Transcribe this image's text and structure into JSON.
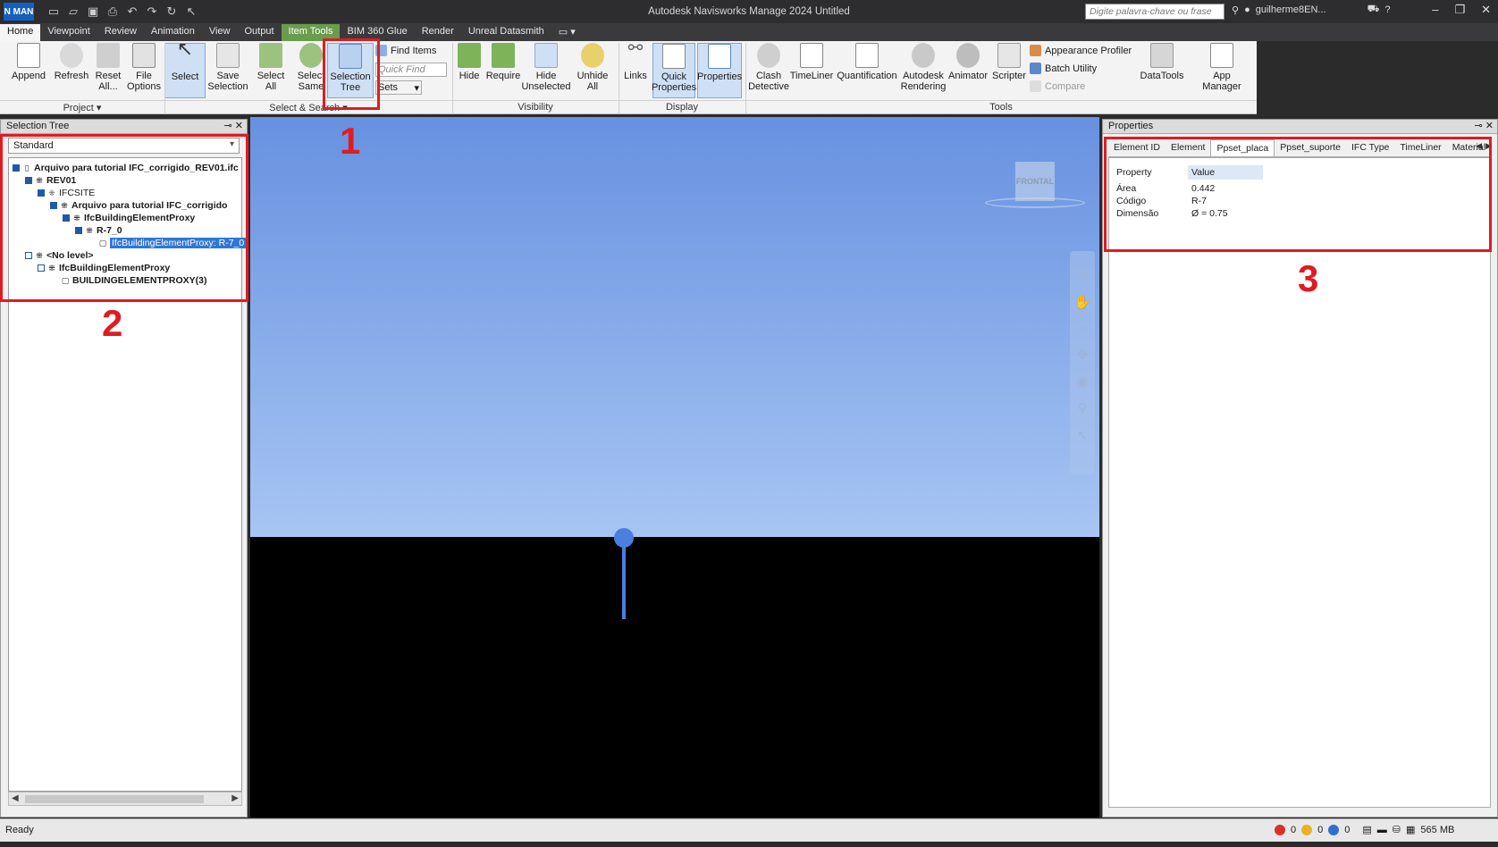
{
  "titlebar": {
    "logo": "N MAN",
    "title": "Autodesk Navisworks Manage 2024    Untitled",
    "search_placeholder": "Digite palavra-chave ou frase",
    "user": "guilherme8EN...",
    "help": "?"
  },
  "tabs": [
    "Home",
    "Viewpoint",
    "Review",
    "Animation",
    "View",
    "Output",
    "Item Tools",
    "BIM 360 Glue",
    "Render",
    "Unreal Datasmith"
  ],
  "ribbon": {
    "project": {
      "append": "Append",
      "refresh": "Refresh",
      "reset": "Reset All...",
      "file_options": "File Options",
      "label": "Project"
    },
    "select_search": {
      "select": "Select",
      "save_selection": "Save Selection",
      "select_all": "Select All",
      "select_same": "Select Same",
      "selection_tree": "Selection Tree",
      "find_items": "Find Items",
      "quick_find": "Quick Find",
      "sets": "Sets",
      "label": "Select & Search"
    },
    "visibility": {
      "hide": "Hide",
      "require": "Require",
      "hide_unselected": "Hide Unselected",
      "unhide_all": "Unhide All",
      "label": "Visibility"
    },
    "display": {
      "links": "Links",
      "quick_properties": "Quick Properties",
      "properties": "Properties",
      "label": "Display"
    },
    "tools": {
      "clash": "Clash Detective",
      "timeliner": "TimeLiner",
      "quantification": "Quantification",
      "autodesk_rendering": "Autodesk Rendering",
      "animator": "Animator",
      "scripter": "Scripter",
      "appearance_profiler": "Appearance Profiler",
      "batch_utility": "Batch Utility",
      "compare": "Compare",
      "datatools": "DataTools",
      "app_manager": "App Manager",
      "label": "Tools"
    }
  },
  "selection_tree": {
    "title": "Selection Tree",
    "dropdown": "Standard",
    "nodes": [
      {
        "label": "Arquivo para tutorial IFC_corrigido_REV01.ifc",
        "bold": true
      },
      {
        "label": "REV01",
        "bold": true
      },
      {
        "label": "IFCSITE",
        "bold": false
      },
      {
        "label": "Arquivo para tutorial IFC_corrigido",
        "bold": true
      },
      {
        "label": "IfcBuildingElementProxy",
        "bold": true
      },
      {
        "label": "R-7_0",
        "bold": true
      },
      {
        "label": "IfcBuildingElementProxy: R-7_0",
        "bold": false
      },
      {
        "label": "<No level>",
        "bold": true
      },
      {
        "label": "IfcBuildingElementProxy",
        "bold": true
      },
      {
        "label": "BUILDINGELEMENTPROXY(3)",
        "bold": true
      }
    ]
  },
  "viewport": {
    "viewcube_label": "FRONTAL"
  },
  "properties": {
    "title": "Properties",
    "tabs": [
      "Element ID",
      "Element",
      "Ppset_placa",
      "Ppset_suporte",
      "IFC Type",
      "TimeLiner",
      "Material"
    ],
    "active_tab": "Ppset_placa",
    "col_property": "Property",
    "col_value": "Value",
    "rows": [
      {
        "property": "Área",
        "value": "0.442"
      },
      {
        "property": "Código",
        "value": "R-7"
      },
      {
        "property": "Dimensão",
        "value": "Ø = 0.75"
      }
    ]
  },
  "annotations": [
    "1",
    "2",
    "3"
  ],
  "status": {
    "text": "Ready",
    "errors": "0",
    "warnings": "0",
    "info": "0",
    "memory": "565 MB"
  },
  "colors": {
    "annotation_red": "#e11b22",
    "selection_blue": "#3076d6",
    "sky_top": "#6791e0",
    "sky_bottom": "#a7c5f3"
  }
}
